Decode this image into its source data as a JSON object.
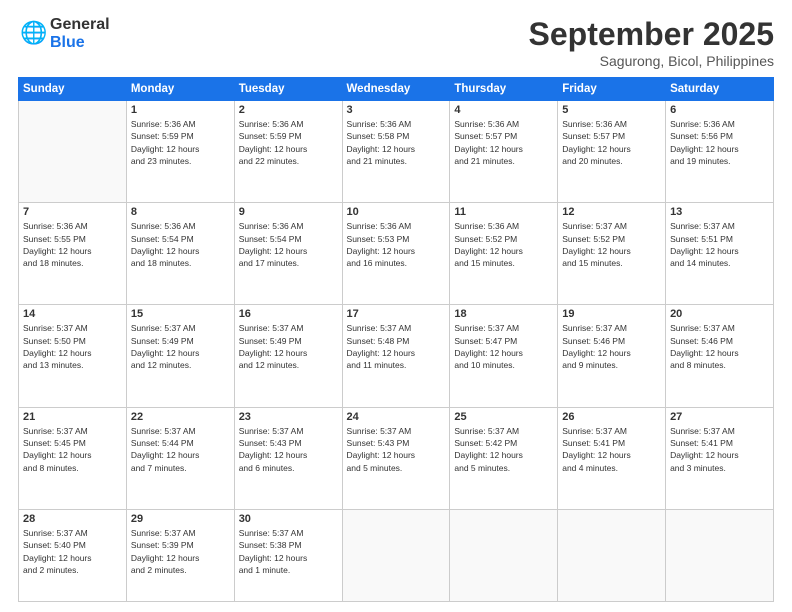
{
  "logo": {
    "general": "General",
    "blue": "Blue"
  },
  "title": "September 2025",
  "location": "Sagurong, Bicol, Philippines",
  "days": [
    "Sunday",
    "Monday",
    "Tuesday",
    "Wednesday",
    "Thursday",
    "Friday",
    "Saturday"
  ],
  "weeks": [
    [
      {
        "day": "",
        "info": ""
      },
      {
        "day": "1",
        "info": "Sunrise: 5:36 AM\nSunset: 5:59 PM\nDaylight: 12 hours\nand 23 minutes."
      },
      {
        "day": "2",
        "info": "Sunrise: 5:36 AM\nSunset: 5:59 PM\nDaylight: 12 hours\nand 22 minutes."
      },
      {
        "day": "3",
        "info": "Sunrise: 5:36 AM\nSunset: 5:58 PM\nDaylight: 12 hours\nand 21 minutes."
      },
      {
        "day": "4",
        "info": "Sunrise: 5:36 AM\nSunset: 5:57 PM\nDaylight: 12 hours\nand 21 minutes."
      },
      {
        "day": "5",
        "info": "Sunrise: 5:36 AM\nSunset: 5:57 PM\nDaylight: 12 hours\nand 20 minutes."
      },
      {
        "day": "6",
        "info": "Sunrise: 5:36 AM\nSunset: 5:56 PM\nDaylight: 12 hours\nand 19 minutes."
      }
    ],
    [
      {
        "day": "7",
        "info": "Sunrise: 5:36 AM\nSunset: 5:55 PM\nDaylight: 12 hours\nand 18 minutes."
      },
      {
        "day": "8",
        "info": "Sunrise: 5:36 AM\nSunset: 5:54 PM\nDaylight: 12 hours\nand 18 minutes."
      },
      {
        "day": "9",
        "info": "Sunrise: 5:36 AM\nSunset: 5:54 PM\nDaylight: 12 hours\nand 17 minutes."
      },
      {
        "day": "10",
        "info": "Sunrise: 5:36 AM\nSunset: 5:53 PM\nDaylight: 12 hours\nand 16 minutes."
      },
      {
        "day": "11",
        "info": "Sunrise: 5:36 AM\nSunset: 5:52 PM\nDaylight: 12 hours\nand 15 minutes."
      },
      {
        "day": "12",
        "info": "Sunrise: 5:37 AM\nSunset: 5:52 PM\nDaylight: 12 hours\nand 15 minutes."
      },
      {
        "day": "13",
        "info": "Sunrise: 5:37 AM\nSunset: 5:51 PM\nDaylight: 12 hours\nand 14 minutes."
      }
    ],
    [
      {
        "day": "14",
        "info": "Sunrise: 5:37 AM\nSunset: 5:50 PM\nDaylight: 12 hours\nand 13 minutes."
      },
      {
        "day": "15",
        "info": "Sunrise: 5:37 AM\nSunset: 5:49 PM\nDaylight: 12 hours\nand 12 minutes."
      },
      {
        "day": "16",
        "info": "Sunrise: 5:37 AM\nSunset: 5:49 PM\nDaylight: 12 hours\nand 12 minutes."
      },
      {
        "day": "17",
        "info": "Sunrise: 5:37 AM\nSunset: 5:48 PM\nDaylight: 12 hours\nand 11 minutes."
      },
      {
        "day": "18",
        "info": "Sunrise: 5:37 AM\nSunset: 5:47 PM\nDaylight: 12 hours\nand 10 minutes."
      },
      {
        "day": "19",
        "info": "Sunrise: 5:37 AM\nSunset: 5:46 PM\nDaylight: 12 hours\nand 9 minutes."
      },
      {
        "day": "20",
        "info": "Sunrise: 5:37 AM\nSunset: 5:46 PM\nDaylight: 12 hours\nand 8 minutes."
      }
    ],
    [
      {
        "day": "21",
        "info": "Sunrise: 5:37 AM\nSunset: 5:45 PM\nDaylight: 12 hours\nand 8 minutes."
      },
      {
        "day": "22",
        "info": "Sunrise: 5:37 AM\nSunset: 5:44 PM\nDaylight: 12 hours\nand 7 minutes."
      },
      {
        "day": "23",
        "info": "Sunrise: 5:37 AM\nSunset: 5:43 PM\nDaylight: 12 hours\nand 6 minutes."
      },
      {
        "day": "24",
        "info": "Sunrise: 5:37 AM\nSunset: 5:43 PM\nDaylight: 12 hours\nand 5 minutes."
      },
      {
        "day": "25",
        "info": "Sunrise: 5:37 AM\nSunset: 5:42 PM\nDaylight: 12 hours\nand 5 minutes."
      },
      {
        "day": "26",
        "info": "Sunrise: 5:37 AM\nSunset: 5:41 PM\nDaylight: 12 hours\nand 4 minutes."
      },
      {
        "day": "27",
        "info": "Sunrise: 5:37 AM\nSunset: 5:41 PM\nDaylight: 12 hours\nand 3 minutes."
      }
    ],
    [
      {
        "day": "28",
        "info": "Sunrise: 5:37 AM\nSunset: 5:40 PM\nDaylight: 12 hours\nand 2 minutes."
      },
      {
        "day": "29",
        "info": "Sunrise: 5:37 AM\nSunset: 5:39 PM\nDaylight: 12 hours\nand 2 minutes."
      },
      {
        "day": "30",
        "info": "Sunrise: 5:37 AM\nSunset: 5:38 PM\nDaylight: 12 hours\nand 1 minute."
      },
      {
        "day": "",
        "info": ""
      },
      {
        "day": "",
        "info": ""
      },
      {
        "day": "",
        "info": ""
      },
      {
        "day": "",
        "info": ""
      }
    ]
  ]
}
